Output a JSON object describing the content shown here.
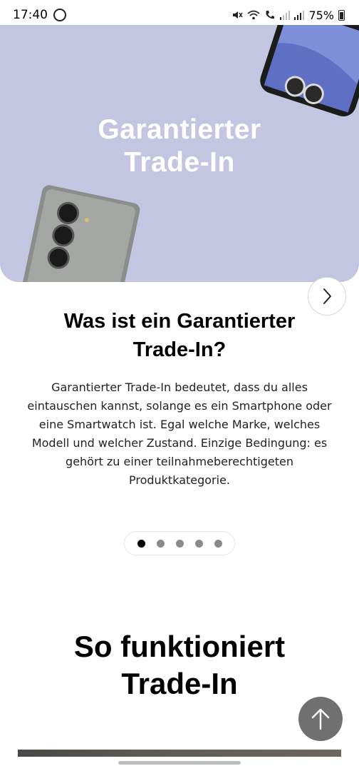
{
  "status_bar": {
    "time": "17:40",
    "battery": "75%"
  },
  "hero": {
    "title_line1": "Garantierter",
    "title_line2": "Trade-In",
    "background_color": "#c4c6e1"
  },
  "section": {
    "heading_line1": "Was ist ein Garantierter",
    "heading_line2": "Trade-In?",
    "body": "Garantierter Trade-In bedeutet, dass du alles eintauschen kannst, solange es ein Smartphone oder eine Smartwatch ist. Egal welche Marke, welches Modell und welcher Zustand. Einzige Bedingung: es gehört zu einer teilnahmeberechtigeten Produktkategorie."
  },
  "carousel": {
    "total_slides": 5,
    "active_slide": 1
  },
  "how_it_works": {
    "heading_line1": "So funktioniert",
    "heading_line2": "Trade-In"
  },
  "icons": {
    "next": "chevron-right-icon",
    "scroll_top": "arrow-up-icon"
  }
}
